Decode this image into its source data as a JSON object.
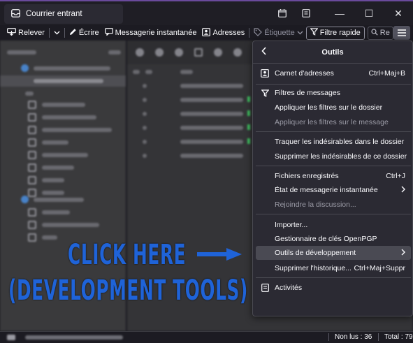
{
  "window": {
    "tab_title": "Courrier entrant",
    "icons": [
      "mail-icon",
      "calendar-icon",
      "address-book-icon"
    ],
    "controls": [
      "minimize",
      "maximize",
      "close"
    ]
  },
  "toolbar": {
    "get_messages": "Relever",
    "write": "Écrire",
    "chat": "Messagerie instantanée",
    "address_book": "Adresses",
    "tag": "Étiquette",
    "quick_filter": "Filtre rapide",
    "search_placeholder": "Re",
    "menu_icon": "hamburger-icon"
  },
  "panel": {
    "title": "Outils",
    "items": [
      {
        "label": "Carnet d'adresses",
        "shortcut": "Ctrl+Maj+B",
        "icon": "address-book-icon",
        "disabled": false
      },
      {
        "label": "Filtres de messages",
        "shortcut": "",
        "icon": "filter-icon",
        "disabled": false
      },
      {
        "label": "Appliquer les filtres sur le dossier",
        "shortcut": "",
        "disabled": false
      },
      {
        "label": "Appliquer les filtres sur le message",
        "shortcut": "",
        "disabled": true
      },
      {
        "label": "Traquer les indésirables dans le dossier",
        "shortcut": "",
        "disabled": false
      },
      {
        "label": "Supprimer les indésirables de ce dossier",
        "shortcut": "",
        "disabled": false
      },
      {
        "label": "Fichiers enregistrés",
        "shortcut": "Ctrl+J",
        "disabled": false
      },
      {
        "label": "État de messagerie instantanée",
        "shortcut": "",
        "submenu": true,
        "disabled": false
      },
      {
        "label": "Rejoindre la discussion...",
        "shortcut": "",
        "disabled": true
      },
      {
        "label": "Importer...",
        "shortcut": "",
        "disabled": false
      },
      {
        "label": "Gestionnaire de clés OpenPGP",
        "shortcut": "",
        "disabled": false
      },
      {
        "label": "Outils de développement",
        "shortcut": "",
        "submenu": true,
        "highlighted": true,
        "disabled": false
      },
      {
        "label": "Supprimer l'historique...",
        "shortcut": "Ctrl+Maj+Suppr",
        "disabled": false
      },
      {
        "label": "Activités",
        "shortcut": "",
        "icon": "activity-icon",
        "disabled": false
      }
    ]
  },
  "annotation": {
    "line1": "CLICK HERE",
    "line2": "(DEVELOPMENT TOOLS)",
    "color": "#1f63d8"
  },
  "statusbar": {
    "unread": "Non lus : 36",
    "total": "Total : 79"
  }
}
